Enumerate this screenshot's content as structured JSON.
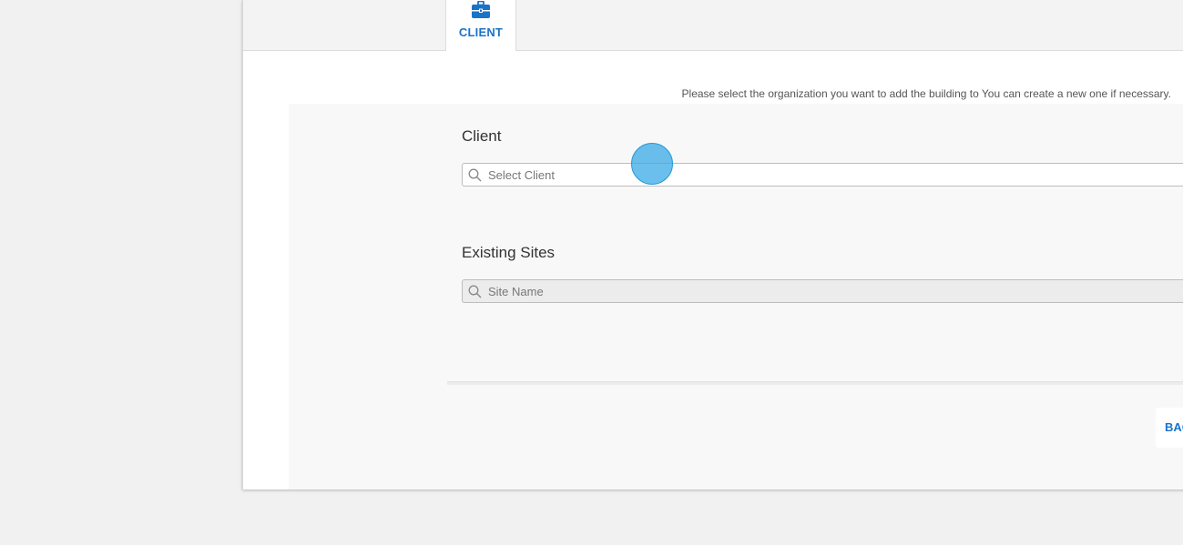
{
  "tabs": [
    {
      "label": "CLIENT",
      "icon": "briefcase-icon",
      "active": true
    }
  ],
  "instructions": "Please select the organization you want to add the building to You can create a new one if necessary.",
  "client_section": {
    "label": "Client",
    "search_placeholder": "Select Client"
  },
  "sites_section": {
    "label": "Existing Sites",
    "search_placeholder": "Site Name"
  },
  "actions": {
    "back_label": "BACK"
  },
  "colors": {
    "accent": "#1a73c8",
    "page_background": "#f1f1f1",
    "panel_background": "#f9f8f8",
    "cursor_indicator": "#38aae6"
  }
}
